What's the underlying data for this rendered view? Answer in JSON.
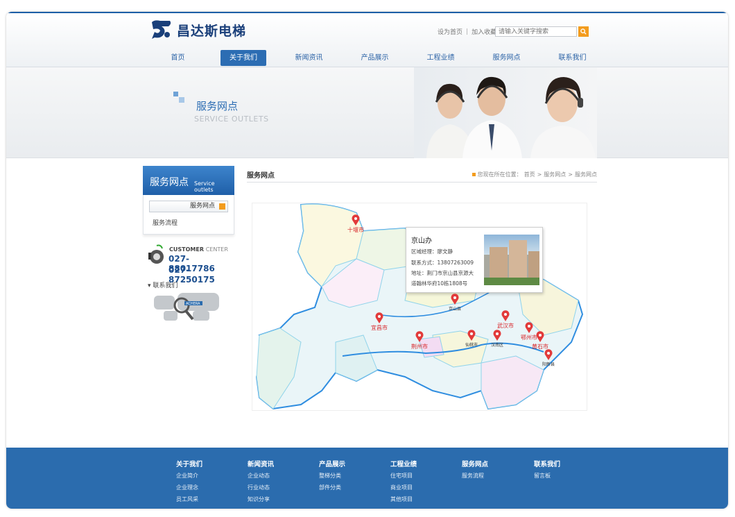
{
  "brand": {
    "name": "昌达斯电梯",
    "color": "#1a3f7a"
  },
  "toplinks": {
    "home": "设为首页",
    "sep": "|",
    "fav": "加入收藏"
  },
  "search": {
    "placeholder": "请输入关键字搜索",
    "icon": "search-icon"
  },
  "nav": {
    "items": [
      {
        "label": "首页"
      },
      {
        "label": "关于我们",
        "active": true
      },
      {
        "label": "新闻资讯"
      },
      {
        "label": "产品展示"
      },
      {
        "label": "工程业绩"
      },
      {
        "label": "服务网点"
      },
      {
        "label": "联系我们"
      }
    ]
  },
  "banner": {
    "title": "服务网点",
    "subtitle": "SERVICE OUTLETS"
  },
  "sidebar": {
    "title": "服务网点",
    "title_en": "Service outlets",
    "items": [
      {
        "label": "服务网点"
      },
      {
        "label": "服务流程"
      }
    ],
    "customer_label": "CUSTOMER",
    "customer_label2": "CENTER",
    "phone1": "027-88017786",
    "phone2": "027-87250175",
    "contact": "联系我们",
    "map_badge": "ACHERA"
  },
  "main": {
    "title": "服务网点",
    "crumb_prefix": "您现在所在位置：",
    "crumb": [
      "首页",
      "服务网点",
      "服务网点"
    ],
    "crumb_sep": ">"
  },
  "map": {
    "markers": [
      {
        "name": "十堰市",
        "major": true
      },
      {
        "name": "京山县",
        "major": false
      },
      {
        "name": "宜昌市",
        "major": true
      },
      {
        "name": "荆州市",
        "major": true
      },
      {
        "name": "仙桃市",
        "major": false
      },
      {
        "name": "汉南区",
        "major": false
      },
      {
        "name": "武汉市",
        "major": true
      },
      {
        "name": "鄂州市",
        "major": true
      },
      {
        "name": "黄石市",
        "major": true
      },
      {
        "name": "阳新县",
        "major": false
      }
    ],
    "popup": {
      "title": "京山办",
      "manager": "区域经理：廖文静",
      "contact": "联系方式：13807263009",
      "address1": "地址：荆门市京山县京源大",
      "address2": "道翰林华府10栋1808号"
    },
    "colors": {
      "border": "#2f8de0",
      "pin": "#e23a3a"
    }
  },
  "footer": {
    "cols": [
      {
        "head": "关于我们",
        "items": [
          "企业简介",
          "企业理念",
          "员工风采"
        ]
      },
      {
        "head": "新闻资讯",
        "items": [
          "企业动态",
          "行业动态",
          "知识分享"
        ]
      },
      {
        "head": "产品展示",
        "items": [
          "整梯分类",
          "部件分类"
        ]
      },
      {
        "head": "工程业绩",
        "items": [
          "住宅项目",
          "商业项目",
          "其他项目"
        ]
      },
      {
        "head": "服务网点",
        "items": [
          "服务流程"
        ]
      },
      {
        "head": "联系我们",
        "items": [
          "留言板"
        ]
      }
    ],
    "color": "#2b6cae"
  }
}
